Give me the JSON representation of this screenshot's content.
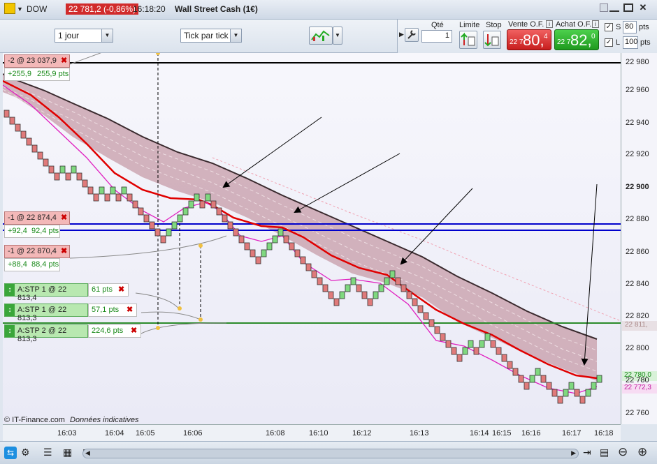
{
  "title_bar": {
    "symbol": "DOW",
    "price_badge": "22 781,2 (-0,86%)",
    "time": "16:18:20",
    "instrument": "Wall Street Cash (1€)"
  },
  "toolbar": {
    "period": "1 jour",
    "mode": "Tick par tick",
    "qty_label": "Qté",
    "qty_value": "1",
    "limite_label": "Limite",
    "stop_label": "Stop",
    "sell_label": "Vente O.F.",
    "sell_prefix": "22 7",
    "sell_big": "80,",
    "sell_small": "4",
    "buy_label": "Achat O.F.",
    "buy_prefix": "22 7",
    "buy_big": "82,",
    "buy_small": "0",
    "s_label": "S",
    "s_value": "80",
    "l_label": "L",
    "l_value": "100",
    "pts": "pts"
  },
  "orders": [
    {
      "label": "-2 @ 23 037,9",
      "pnl_a": "+255,9",
      "pnl_b": "255,9 pts"
    },
    {
      "label": "-1 @ 22 874,4",
      "pnl_a": "+92,4",
      "pnl_b": "92,4 pts"
    },
    {
      "label": "-1 @ 22 870,4",
      "pnl_a": "+88,4",
      "pnl_b": "88,4 pts"
    }
  ],
  "stops": [
    {
      "label": "A:STP  1 @ 22 813,4",
      "pts": "61 pts"
    },
    {
      "label": "A:STP  1 @ 22 813,3",
      "pts": "57,1 pts"
    },
    {
      "label": "A:STP  2 @ 22 813,3",
      "pts": "224,6 pts"
    }
  ],
  "yaxis": {
    "ticks": [
      "22 980",
      "22 960",
      "22 940",
      "22 920",
      "22 900",
      "22 880",
      "22 860",
      "22 840",
      "22 820",
      "22 800",
      "22 780",
      "22 760"
    ],
    "tag_green": "22 780,0",
    "tag_pink": "22 772,3",
    "tag_grey": "22 811,"
  },
  "xaxis": {
    "ticks": [
      "16:03",
      "16:04",
      "16:05",
      "16:06",
      "16:08",
      "16:10",
      "16:12",
      "16:13",
      "16:14",
      "16:15",
      "16:16",
      "16:17",
      "16:18"
    ]
  },
  "footer": {
    "credit": "© IT-Finance.com",
    "note": "Données indicatives"
  },
  "colors": {
    "up": "#7fd87f",
    "down": "#e07a7a",
    "ma_red": "#e00000",
    "ma_pink": "#e020c0",
    "band": "#c9a7b3",
    "blue_line": "#0000cc",
    "green_line": "#2a8a2a"
  }
}
